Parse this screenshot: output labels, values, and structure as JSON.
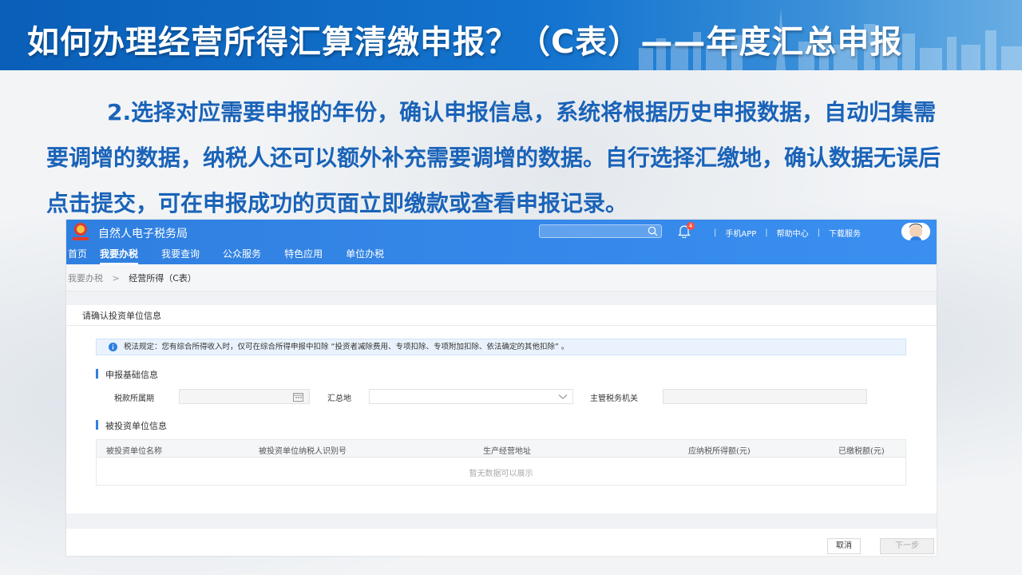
{
  "slide": {
    "title": "如何办理经营所得汇算清缴申报？（C表）——年度汇总申报",
    "paragraph": "2.选择对应需要申报的年份，确认申报信息，系统将根据历史申报数据，自动归集需要调增的数据，纳税人还可以额外补充需要调增的数据。自行选择汇缴地，确认数据无误后点击提交，可在申报成功的页面立即缴款或查看申报记录。"
  },
  "app": {
    "title": "自然人电子税务局",
    "search_placeholder": "",
    "notification_count": "4",
    "header_links": [
      "手机APP",
      "帮助中心",
      "下载服务"
    ],
    "nav": [
      "首页",
      "我要办税",
      "我要查询",
      "公众服务",
      "特色应用",
      "单位办税"
    ],
    "active_nav": "我要办税",
    "breadcrumb": {
      "parent": "我要办税",
      "current": "经营所得（C表）"
    },
    "section_title": "请确认投资单位信息",
    "notice": "税法规定：您有综合所得收入时，仅可在综合所得申报中扣除 “投资者减除费用、专项扣除、专项附加扣除、依法确定的其他扣除” 。",
    "basic_info": {
      "title": "申报基础信息",
      "period_label": "税款所属期",
      "period_value": "",
      "region_label": "汇总地",
      "region_value": "",
      "tax_office_label": "主管税务机关",
      "tax_office_value": ""
    },
    "investee": {
      "title": "被投资单位信息",
      "columns": [
        "被投资单位名称",
        "被投资单位纳税人识别号",
        "生产经营地址",
        "应纳税所得额(元)",
        "已缴税额(元)"
      ],
      "empty_text": "暂无数据可以展示"
    },
    "buttons": {
      "cancel": "取消",
      "next": "下一步"
    },
    "colors": {
      "header_blue": "#2f7fe0",
      "banner_blue": "#0a5fb8",
      "paragraph_blue": "#1a63b8"
    }
  }
}
